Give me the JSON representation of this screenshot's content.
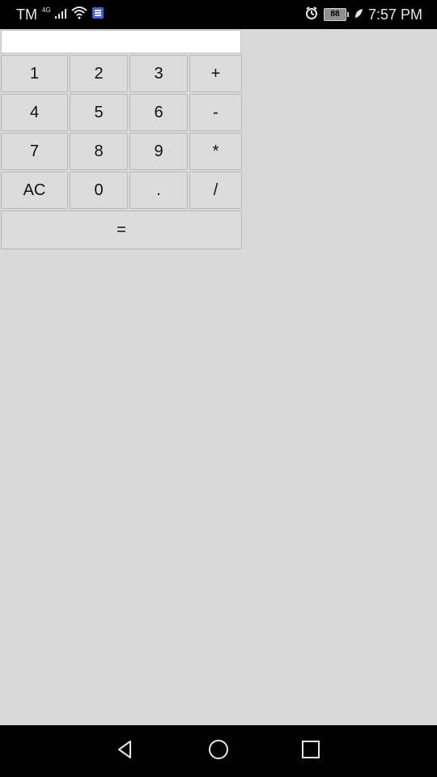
{
  "status_bar": {
    "carrier": "TM",
    "network": "4G",
    "battery": "88",
    "time": "7:57 PM"
  },
  "calculator": {
    "display_value": "",
    "keys": [
      "1",
      "2",
      "3",
      "+",
      "4",
      "5",
      "6",
      "-",
      "7",
      "8",
      "9",
      "*",
      "AC",
      "0",
      ".",
      "/",
      "="
    ]
  },
  "nav_bar": {
    "back": "back-icon",
    "home": "home-icon",
    "recents": "recents-icon"
  },
  "colors": {
    "background": "#d9d9d9",
    "key_bg": "#dcdcdc",
    "status_bar": "#000000",
    "display_bg": "#ffffff"
  }
}
